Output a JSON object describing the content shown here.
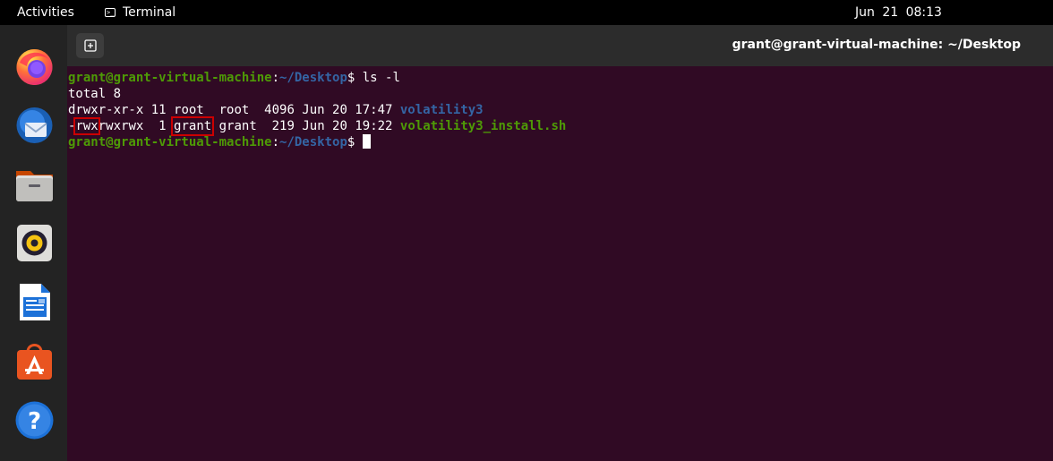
{
  "topbar": {
    "activities": "Activities",
    "app_name": "Terminal",
    "datetime": "Jun 21  08:13"
  },
  "dock": {
    "apps": [
      "firefox-icon",
      "thunderbird-icon",
      "files-icon",
      "rhythmbox-icon",
      "libreoffice-writer-icon",
      "software-center-icon",
      "help-icon"
    ]
  },
  "terminal": {
    "title": "grant@grant-virtual-machine: ~/Desktop",
    "prompt_user": "grant@grant-virtual-machine",
    "prompt_colon": ":",
    "prompt_path": "~/Desktop",
    "prompt_symbol": "$",
    "command": " ls -l",
    "total": "total 8",
    "row1": {
      "perms": "drwxr-xr-x",
      "rest": " 11 root  root  4096 Jun 20 17:47 ",
      "name": "volatility3"
    },
    "row2": {
      "perm_type": "-",
      "perm_owner": "rwx",
      "perm_rest": "rwxrwx",
      "links": "  1 ",
      "owner": "grant",
      "rest": " grant  219 Jun 20 19:22 ",
      "name": "volatility3_install.sh"
    }
  },
  "colors": {
    "terminal_bg": "#300a24",
    "prompt_green": "#4e9a06",
    "path_blue": "#3465a4",
    "highlight_red": "#cc0000"
  }
}
